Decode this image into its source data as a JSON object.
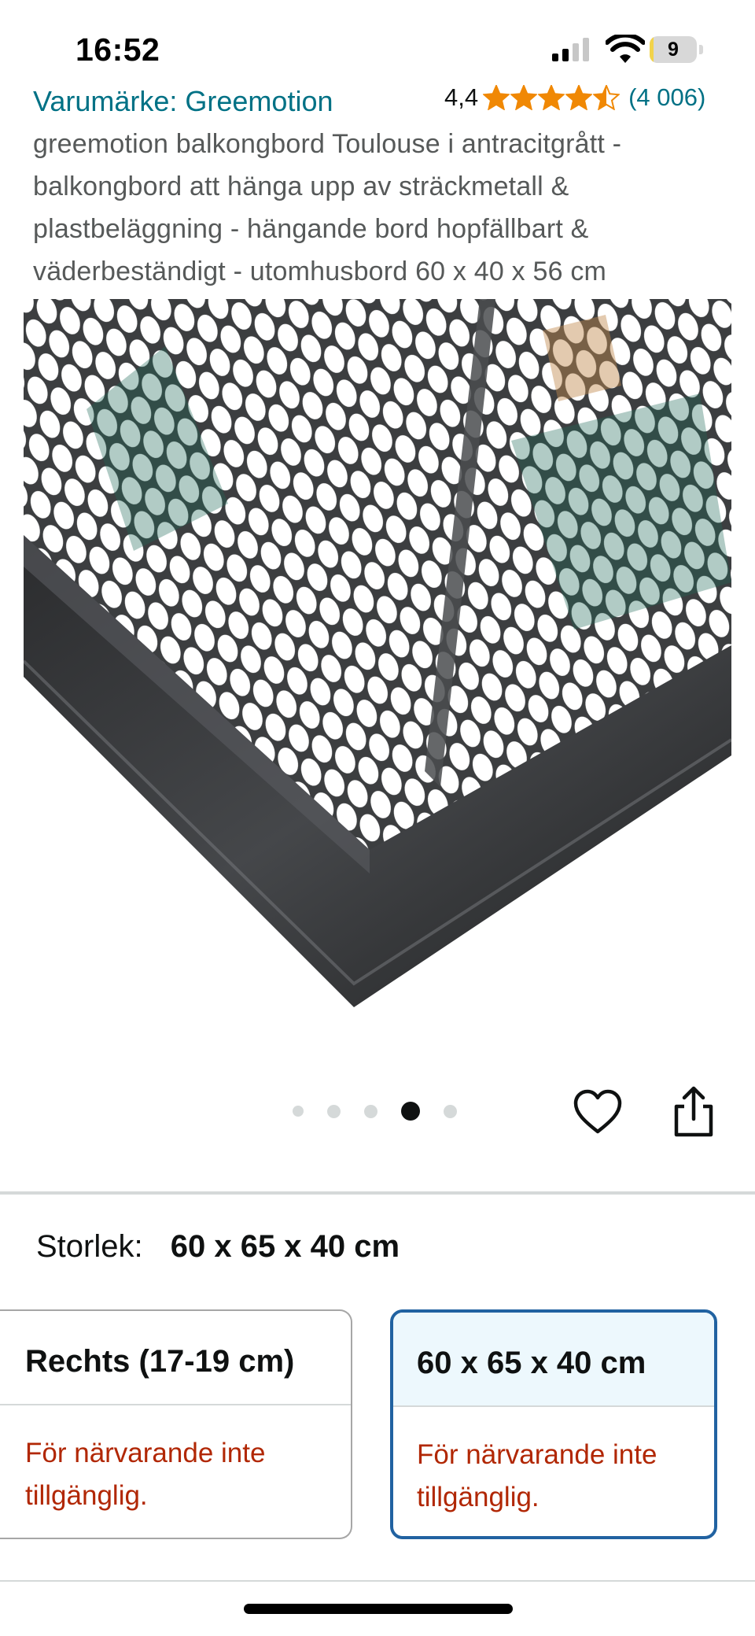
{
  "status_bar": {
    "time": "16:52",
    "battery_level": "9"
  },
  "product": {
    "brand_link": "Varumärke: Greemotion",
    "rating_value": "4,4",
    "rating_stars": 4.5,
    "rating_count": "(4 006)",
    "title": "greemotion balkongbord Toulouse i antracitgrått - balkongbord att hänga upp av sträckmetall & plastbeläggning - hängande bord hopfällbart & väderbeständigt - utomhusbord 60 x 40 x 56 cm"
  },
  "carousel": {
    "image_count": 5,
    "active_index": 3
  },
  "size": {
    "label": "Storlek:",
    "value": "60 x 65 x 40 cm"
  },
  "options": [
    {
      "title": "Rechts (17-19 cm)",
      "availability": "För närvarande inte tillgänglig.",
      "selected": false
    },
    {
      "title": "60 x 65 x 40 cm",
      "availability": "För närvarande inte tillgänglig.",
      "selected": true
    }
  ],
  "colors": {
    "link": "#007185",
    "star": "#f08804",
    "unavailable": "#b12704",
    "selected_border": "#2162a1"
  }
}
